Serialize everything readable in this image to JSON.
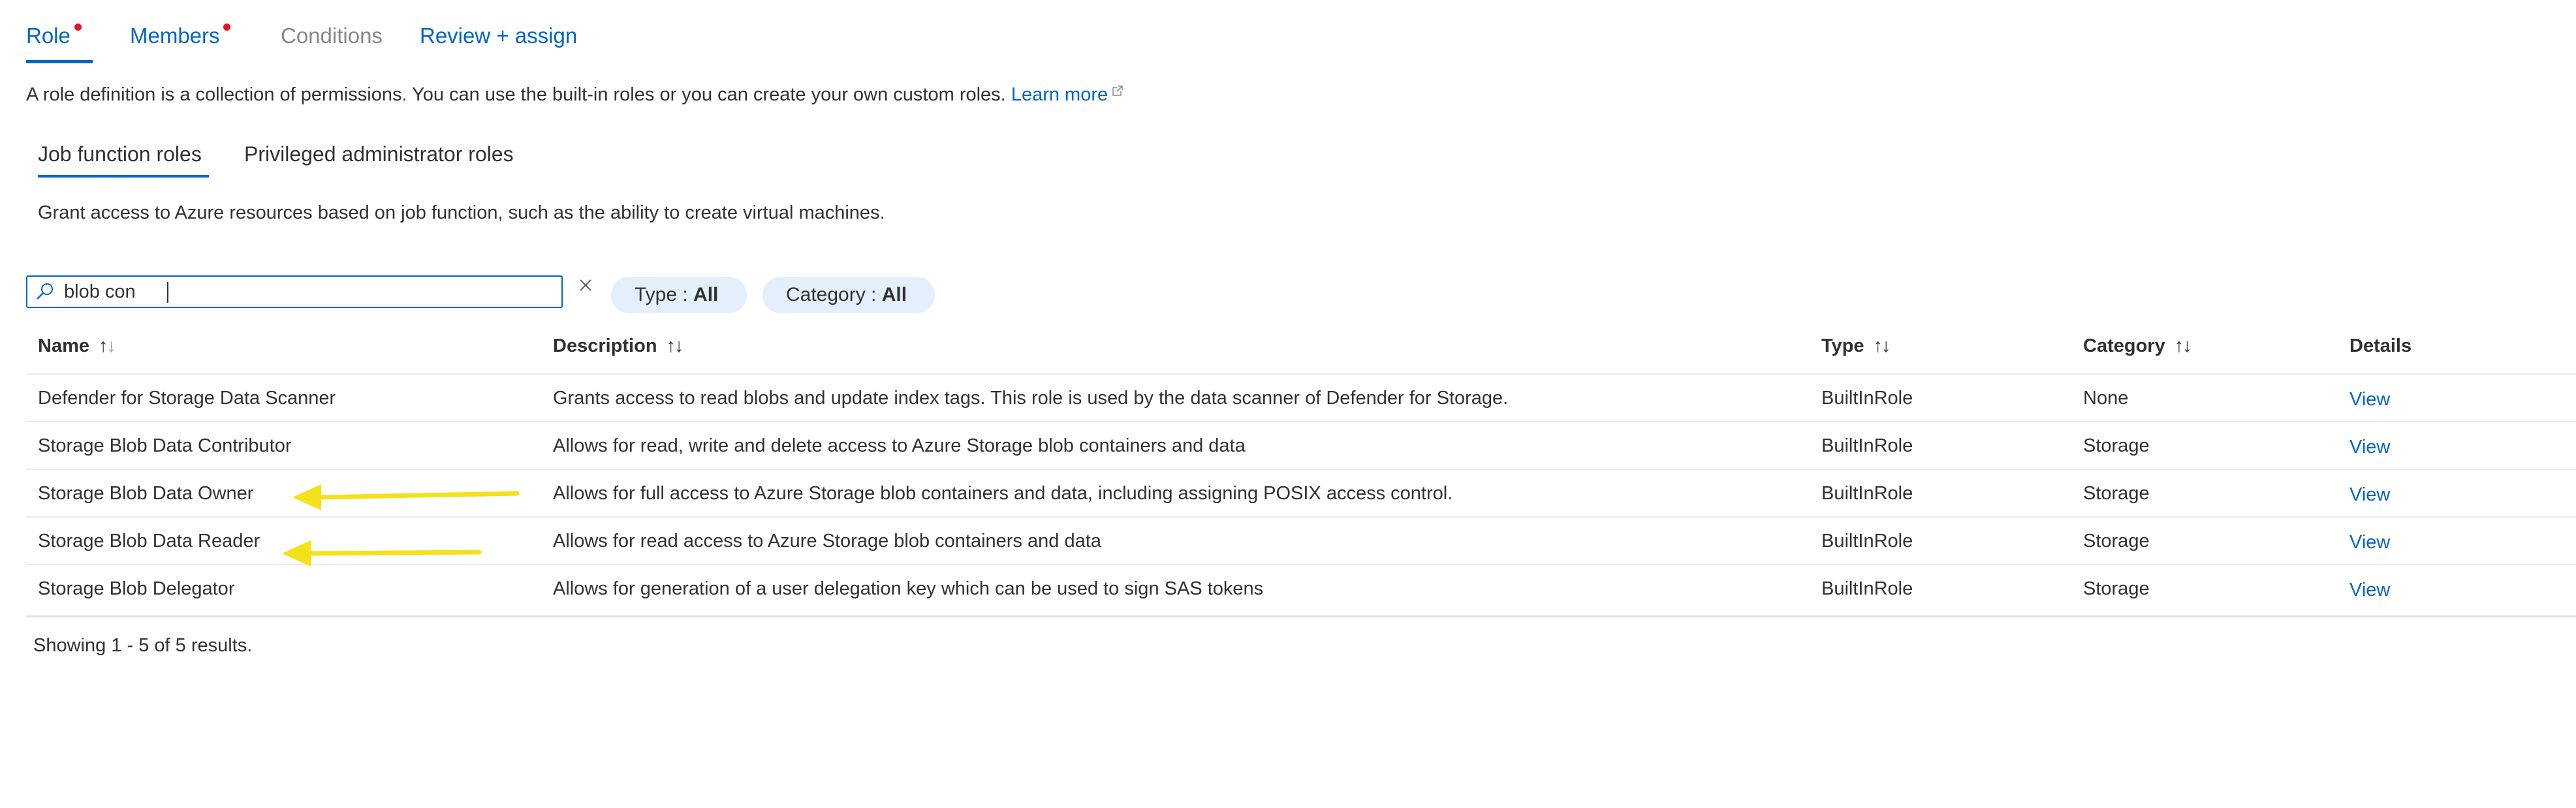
{
  "tabs": [
    {
      "label": "Role",
      "state": "active",
      "has_dot": true
    },
    {
      "label": "Members",
      "state": "normal",
      "has_dot": true
    },
    {
      "label": "Conditions",
      "state": "disabled",
      "has_dot": false
    },
    {
      "label": "Review + assign",
      "state": "normal",
      "has_dot": false
    }
  ],
  "intro": {
    "text": "A role definition is a collection of permissions. You can use the built-in roles or you can create your own custom roles.",
    "learn_more": "Learn more"
  },
  "subtabs": [
    {
      "label": "Job function roles",
      "active": true
    },
    {
      "label": "Privileged administrator roles",
      "active": false
    }
  ],
  "subtab_description": "Grant access to Azure resources based on job function, such as the ability to create virtual machines.",
  "search": {
    "value": "blob con"
  },
  "filters": [
    {
      "label": "Type : ",
      "value": "All"
    },
    {
      "label": "Category : ",
      "value": "All"
    }
  ],
  "table": {
    "headers": [
      "Name",
      "Description",
      "Type",
      "Category",
      "Details"
    ],
    "rows": [
      {
        "name": "Defender for Storage Data Scanner",
        "description": "Grants access to read blobs and update index tags. This role is used by the data scanner of Defender for Storage.",
        "type": "BuiltInRole",
        "category": "None",
        "details": "View"
      },
      {
        "name": "Storage Blob Data Contributor",
        "description": "Allows for read, write and delete access to Azure Storage blob containers and data",
        "type": "BuiltInRole",
        "category": "Storage",
        "details": "View"
      },
      {
        "name": "Storage Blob Data Owner",
        "description": "Allows for full access to Azure Storage blob containers and data, including assigning POSIX access control.",
        "type": "BuiltInRole",
        "category": "Storage",
        "details": "View"
      },
      {
        "name": "Storage Blob Data Reader",
        "description": "Allows for read access to Azure Storage blob containers and data",
        "type": "BuiltInRole",
        "category": "Storage",
        "details": "View"
      },
      {
        "name": "Storage Blob Delegator",
        "description": "Allows for generation of a user delegation key which can be used to sign SAS tokens",
        "type": "BuiltInRole",
        "category": "Storage",
        "details": "View"
      }
    ]
  },
  "status_text": "Showing 1 - 5 of 5 results.",
  "colors": {
    "accent": "#0064c8",
    "dot": "#e81123",
    "pill_bg": "#e3effb",
    "annotation": "#f5e11a"
  },
  "annotations": [
    {
      "icon": "arrow-left-icon",
      "points_to_row": 2
    },
    {
      "icon": "arrow-left-icon",
      "points_to_row": 3
    }
  ]
}
